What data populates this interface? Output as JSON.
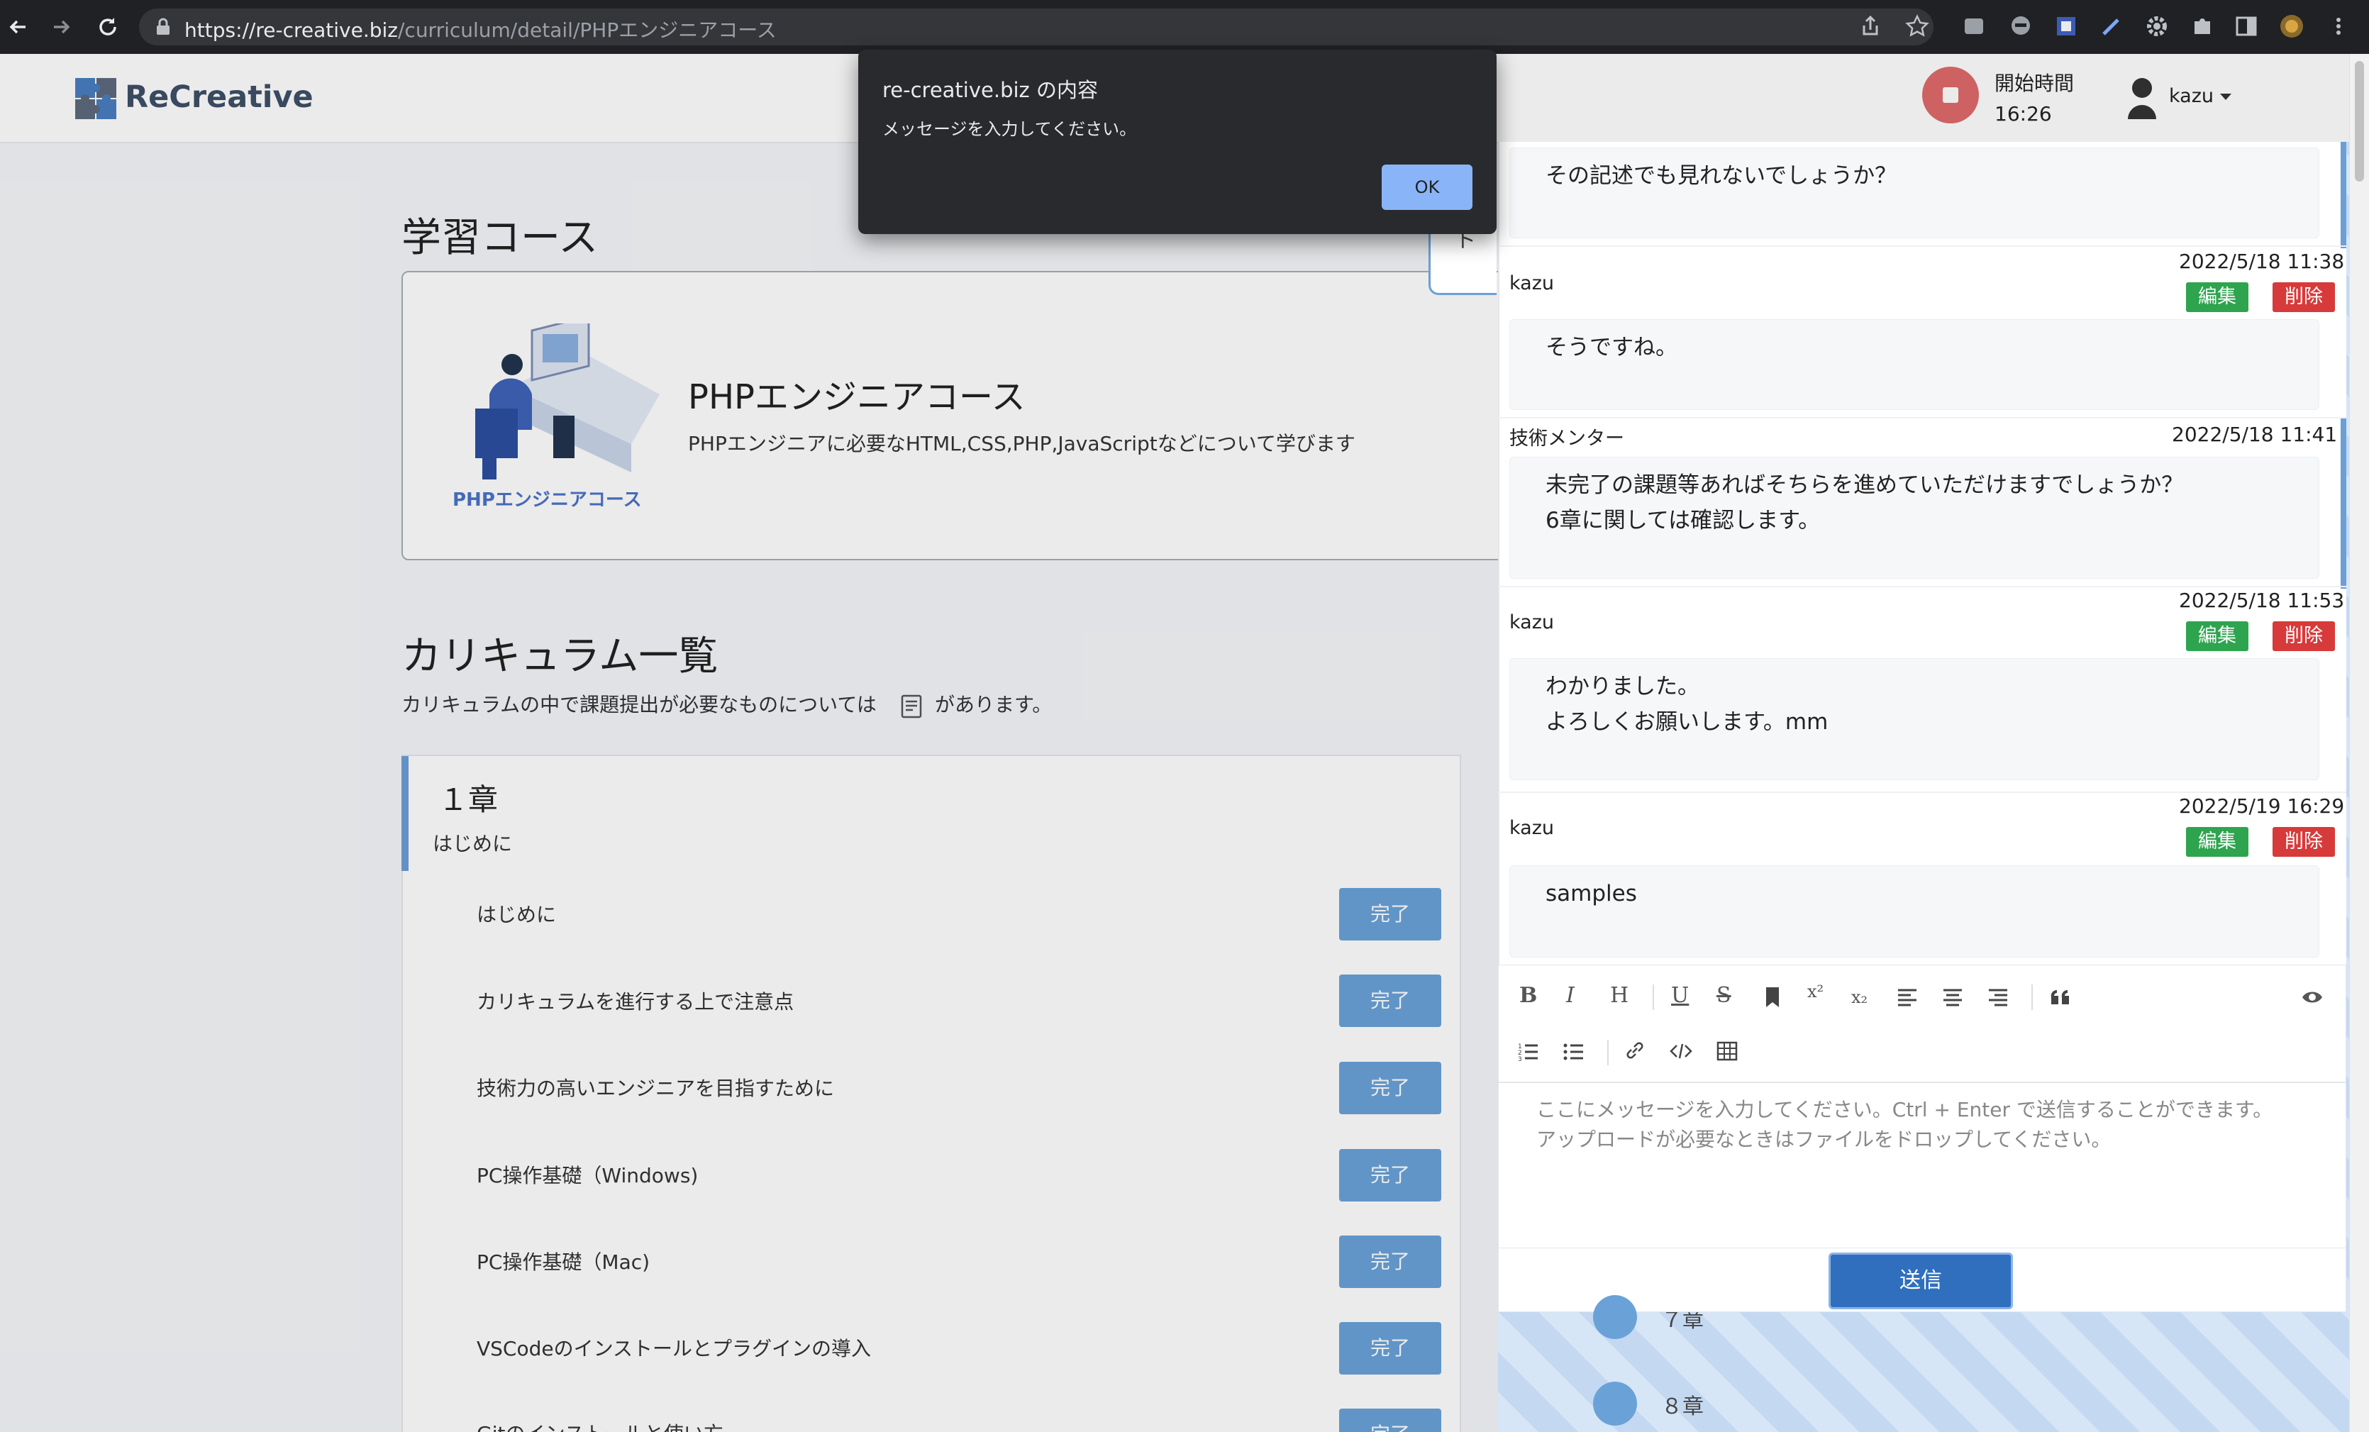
{
  "browser": {
    "url_host": "https://re-creative.biz",
    "url_path": "/curriculum/detail/PHPエンジニアコース"
  },
  "header": {
    "logo_text": "ReCreative",
    "timer_label": "開始時間",
    "timer_value": "16:26",
    "user_name": "kazu"
  },
  "course": {
    "heading": "学習コース",
    "title": "PHPエンジニアコース",
    "description": "PHPエンジニアに必要なHTML,CSS,PHP,JavaScriptなどについて学びます",
    "image_caption": "PHPエンジニアコース"
  },
  "curriculum": {
    "heading": "カリキュラム一覧",
    "note_before": "カリキュラムの中で課題提出が必要なものについては",
    "note_after": "があります。",
    "chapter_title": "１章",
    "chapter_subtitle": "はじめに",
    "lessons": [
      {
        "title": "はじめに",
        "status": "完了"
      },
      {
        "title": "カリキュラムを進行する上で注意点",
        "status": "完了"
      },
      {
        "title": "技術力の高いエンジニアを目指すために",
        "status": "完了"
      },
      {
        "title": "PC操作基礎（Windows)",
        "status": "完了"
      },
      {
        "title": "PC操作基礎（Mac)",
        "status": "完了"
      },
      {
        "title": "VSCodeのインストールとプラグインの導入",
        "status": "完了"
      },
      {
        "title": "Gitのインストールと使い方",
        "status": "完了"
      }
    ]
  },
  "side_tab_text": "ト",
  "chat": {
    "edit_label": "編集",
    "delete_label": "削除",
    "messages": [
      {
        "author": "",
        "time": "",
        "lines": [
          "その記述でも見れないでしょうか？"
        ]
      },
      {
        "author": "kazu",
        "time": "2022/5/18 11:38",
        "lines": [
          "そうですね。"
        ]
      },
      {
        "author": "技術メンター",
        "time": "2022/5/18 11:41",
        "lines": [
          "未完了の課題等あればそちらを進めていただけますでしょうか？",
          "6章に関しては確認します。"
        ]
      },
      {
        "author": "kazu",
        "time": "2022/5/18 11:53",
        "lines": [
          "わかりました。",
          "よろしくお願いします。mm"
        ]
      },
      {
        "author": "kazu",
        "time": "2022/5/19 16:29",
        "lines": [
          "samples"
        ]
      }
    ],
    "placeholder_line1": "ここにメッセージを入力してください。Ctrl + Enter で送信することができます。",
    "placeholder_line2": "アップロードが必要なときはファイルをドロップしてください。",
    "send_label": "送信"
  },
  "chapter_nav": [
    {
      "label": "７章"
    },
    {
      "label": "８章"
    }
  ],
  "dialog": {
    "title": "re-creative.biz の内容",
    "message": "メッセージを入力してください。",
    "ok_label": "OK"
  }
}
